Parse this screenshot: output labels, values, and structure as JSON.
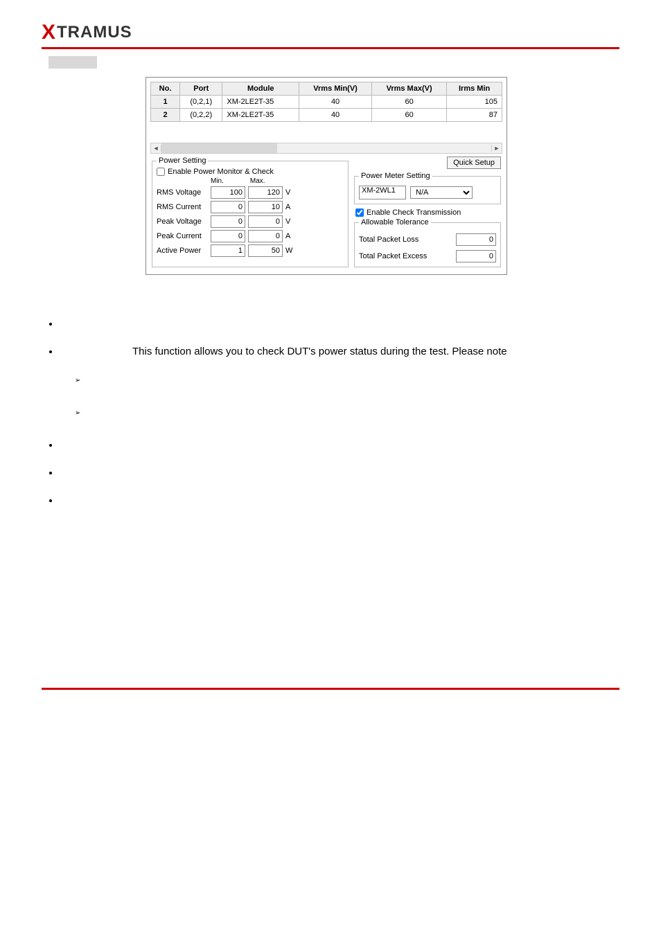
{
  "logo": {
    "text": "TRAMUS"
  },
  "table": {
    "headers": [
      "No.",
      "Port",
      "Module",
      "Vrms Min(V)",
      "Vrms Max(V)",
      "Irms Min"
    ],
    "rows": [
      {
        "no": "1",
        "port": "(0,2,1)",
        "module": "XM-2LE2T-35",
        "vmin": "40",
        "vmax": "60",
        "imin": "105"
      },
      {
        "no": "2",
        "port": "(0,2,2)",
        "module": "XM-2LE2T-35",
        "vmin": "40",
        "vmax": "60",
        "imin": "87"
      }
    ]
  },
  "power_setting": {
    "legend": "Power Setting",
    "enable_label": "Enable Power Monitor & Check",
    "min_label": "Min.",
    "max_label": "Max.",
    "rows": [
      {
        "label": "RMS Voltage",
        "min": "100",
        "max": "120",
        "unit": "V"
      },
      {
        "label": "RMS Current",
        "min": "0",
        "max": "10",
        "unit": "A"
      },
      {
        "label": "Peak Voltage",
        "min": "0",
        "max": "0",
        "unit": "V"
      },
      {
        "label": "Peak Current",
        "min": "0",
        "max": "0",
        "unit": "A"
      },
      {
        "label": "Active Power",
        "min": "1",
        "max": "50",
        "unit": "W"
      }
    ]
  },
  "quick_setup": "Quick Setup",
  "pms": {
    "legend": "Power Meter Setting",
    "device": "XM-2WL1",
    "option": "N/A"
  },
  "enable_check_trans": "Enable Check Transmission",
  "allowable": {
    "legend": "Allowable Tolerance",
    "loss_label": "Total Packet Loss",
    "loss_val": "0",
    "excess_label": "Total Packet Excess",
    "excess_val": "0"
  },
  "body_line": "This function allows you to check DUT's power status during the test. Please note"
}
